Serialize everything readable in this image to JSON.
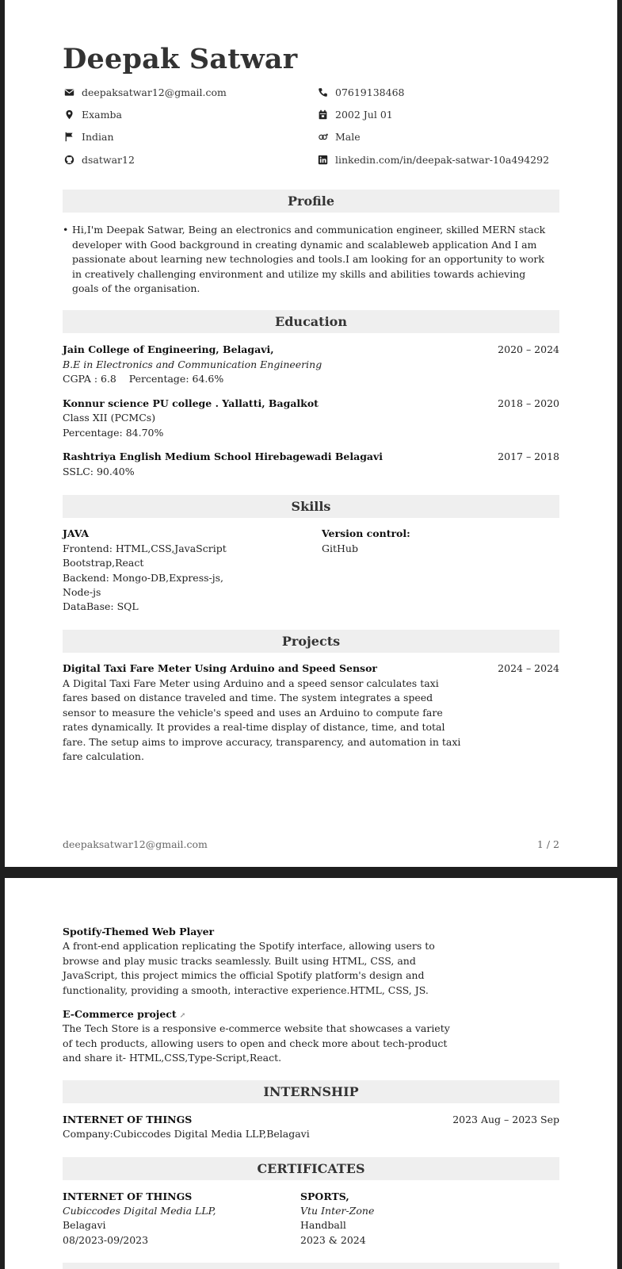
{
  "header": {
    "name": "Deepak Satwar",
    "email": "deepaksatwar12@gmail.com",
    "phone": "07619138468",
    "location": "Examba",
    "dob": "2002 Jul 01",
    "nationality": "Indian",
    "gender": "Male",
    "github": "dsatwar12",
    "linkedin": "linkedin.com/in/deepak-satwar-10a494292"
  },
  "profile": {
    "title": "Profile",
    "text": "Hi,I'm Deepak Satwar, Being an electronics and communication engineer, skilled MERN stack developer with Good background in creating dynamic and scalableweb application And I am passionate about learning new technologies and tools.I am looking for an opportunity to work in creatively challenging environment and utilize my skills and abilities towards achieving goals of the organisation."
  },
  "education": {
    "title": "Education",
    "items": [
      {
        "school": "Jain College of Engineering, Belagavi,",
        "dates": "2020 – 2024",
        "line1": "B.E in Electronics and Communication Engineering",
        "line2": "CGPA : 6.8    Percentage: 64.6%"
      },
      {
        "school": "Konnur science PU college . Yallatti, Bagalkot",
        "dates": "2018 – 2020",
        "line1": "Class XII (PCMCs)",
        "line2": "Percentage: 84.70%"
      },
      {
        "school": "Rashtriya English Medium School Hirebagewadi Belagavi",
        "dates": "2017 – 2018",
        "line1": "SSLC: 90.40%"
      }
    ]
  },
  "skills": {
    "title": "Skills",
    "left_title": "JAVA",
    "left_lines": [
      "Frontend: HTML,CSS,JavaScript",
      "Bootstrap,React",
      "Backend: Mongo-DB,Express-js,",
      "Node-js",
      "DataBase: SQL"
    ],
    "right_title": "Version control:",
    "right_lines": [
      "GitHub"
    ]
  },
  "projects": {
    "title": "Projects",
    "items": [
      {
        "name": "Digital Taxi Fare Meter Using Arduino and Speed Sensor",
        "dates": "2024 – 2024",
        "lines": [
          "A Digital Taxi Fare Meter using Arduino and a speed sensor calculates taxi",
          "fares based on distance traveled and time. The system integrates a speed",
          "sensor to measure the vehicle's speed and uses an Arduino to compute fare",
          "rates dynamically. It provides a real-time display of distance, time, and total",
          "fare. The setup aims to improve accuracy, transparency, and automation in taxi",
          "fare calculation."
        ]
      },
      {
        "name": "Spotify-Themed Web Player",
        "lines": [
          "A front-end application replicating the Spotify interface, allowing users to",
          "browse and play music tracks seamlessly. Built using HTML, CSS, and",
          "JavaScript, this project mimics the official Spotify platform's design and",
          "functionality, providing a smooth, interactive experience.HTML, CSS, JS."
        ]
      },
      {
        "name": "E-Commerce project",
        "lines": [
          "The Tech Store is a responsive e-commerce website that showcases a variety",
          "of tech products, allowing users to open and check more about tech-product",
          "and share it- HTML,CSS,Type-Script,React."
        ]
      }
    ]
  },
  "footer": {
    "email": "deepaksatwar12@gmail.com",
    "page": "1 / 2"
  },
  "internship": {
    "title": "INTERNSHIP",
    "role": "INTERNET OF THINGS",
    "dates": "2023 Aug – 2023 Sep",
    "company": "Company:Cubiccodes Digital Media LLP,Belagavi"
  },
  "certificates": {
    "title": "CERTIFICATES",
    "items": [
      {
        "name": "INTERNET OF THINGS",
        "issuer": "Cubiccodes Digital Media LLP,",
        "line2": "Belagavi",
        "line3": "08/2023-09/2023"
      },
      {
        "name": "SPORTS,",
        "issuer": "Vtu Inter-Zone",
        "line2": "Handball",
        "line3": "2023 & 2024"
      }
    ]
  },
  "icons": [
    "envelope-icon",
    "phone-icon",
    "map-pin-icon",
    "calendar-icon",
    "flag-icon",
    "gender-icon",
    "github-icon",
    "linkedin-icon",
    "external-link-icon"
  ]
}
